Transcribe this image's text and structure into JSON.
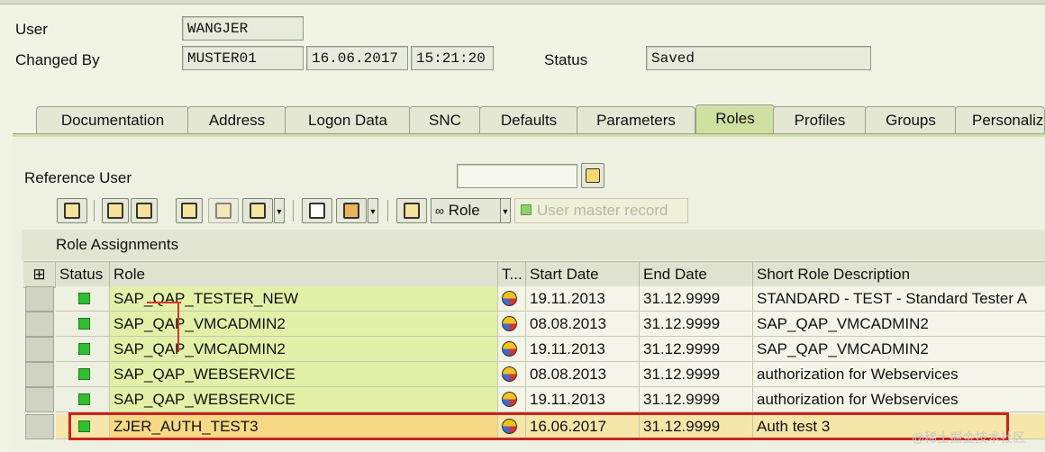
{
  "header": {
    "user_label": "User",
    "user_value": "WANGJER",
    "changed_by_label": "Changed By",
    "changed_by_value": "MUSTER01",
    "changed_date": "16.06.2017",
    "changed_time": "15:21:20",
    "status_label": "Status",
    "status_value": "Saved"
  },
  "tabs": [
    {
      "label": "Documentation"
    },
    {
      "label": "Address"
    },
    {
      "label": "Logon Data"
    },
    {
      "label": "SNC"
    },
    {
      "label": "Defaults"
    },
    {
      "label": "Parameters"
    },
    {
      "label": "Roles",
      "active": true
    },
    {
      "label": "Profiles"
    },
    {
      "label": "Groups"
    },
    {
      "label": "Personaliz"
    }
  ],
  "reference_user": {
    "label": "Reference User",
    "value": ""
  },
  "toolbar": {
    "role_button_label": "Role",
    "user_master_record_label": "User master record"
  },
  "section_title": "Role Assignments",
  "table": {
    "columns": [
      "Status",
      "Role",
      "T...",
      "Start Date",
      "End Date",
      "Short Role Description"
    ],
    "rows": [
      {
        "role": "SAP_QAP_TESTER_NEW",
        "start": "19.11.2013",
        "end": "31.12.9999",
        "desc": "STANDARD - TEST - Standard Tester A"
      },
      {
        "role": "SAP_QAP_VMCADMIN2",
        "start": "08.08.2013",
        "end": "31.12.9999",
        "desc": "SAP_QAP_VMCADMIN2"
      },
      {
        "role": "SAP_QAP_VMCADMIN2",
        "start": "19.11.2013",
        "end": "31.12.9999",
        "desc": "SAP_QAP_VMCADMIN2"
      },
      {
        "role": "SAP_QAP_WEBSERVICE",
        "start": "08.08.2013",
        "end": "31.12.9999",
        "desc": "authorization for Webservices"
      },
      {
        "role": "SAP_QAP_WEBSERVICE",
        "start": "19.11.2013",
        "end": "31.12.9999",
        "desc": "authorization for Webservices"
      },
      {
        "role": "ZJER_AUTH_TEST3",
        "start": "16.06.2017",
        "end": "31.12.9999",
        "desc": "Auth test 3",
        "highlighted": true
      }
    ]
  },
  "watermark": "@稀土掘金技术社区",
  "colors": {
    "active_tab": "#cfe0a3",
    "role_cell": "#e3f0a8",
    "highlight_box": "#c8231f",
    "status_green": "#2fbf2f"
  }
}
